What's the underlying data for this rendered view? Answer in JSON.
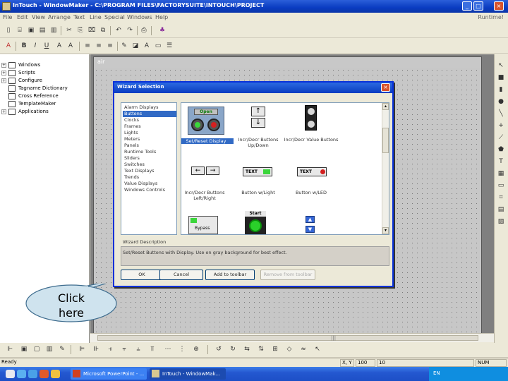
{
  "window": {
    "title": "InTouch - WindowMaker - C:\\PROGRAM FILES\\FACTORYSUITE\\INTOUCH\\PROJECT",
    "minimize": "_",
    "maximize": "□",
    "close": "×"
  },
  "menu": {
    "items": [
      "File",
      "Edit",
      "View",
      "Arrange",
      "Text",
      "Line",
      "Special",
      "Windows",
      "Help"
    ],
    "runtime": "Runtime!"
  },
  "tree": {
    "items": [
      {
        "label": "Windows",
        "expander": "+"
      },
      {
        "label": "Scripts",
        "expander": "+"
      },
      {
        "label": "Configure",
        "expander": "+"
      },
      {
        "label": "Tagname Dictionary",
        "expander": ""
      },
      {
        "label": "Cross Reference",
        "expander": ""
      },
      {
        "label": "TemplateMaker",
        "expander": ""
      },
      {
        "label": "Applications",
        "expander": "+"
      }
    ]
  },
  "canvas_window": {
    "title": "air"
  },
  "dialog": {
    "title": "Wizard Selection",
    "close": "×",
    "categories": [
      "Alarm Displays",
      "Buttons",
      "Clocks",
      "Frames",
      "Lights",
      "Meters",
      "Panels",
      "Runtime Tools",
      "Sliders",
      "Switches",
      "Text Displays",
      "Trends",
      "Value Displays",
      "Windows Controls"
    ],
    "selected_category": "Buttons",
    "wizards": [
      {
        "caption": "Set/Reset Display",
        "selected": true
      },
      {
        "caption": "Incr/Decr Buttons Up/Down",
        "selected": false
      },
      {
        "caption": "Incr/Decr Value Buttons",
        "selected": false
      },
      {
        "caption": "Incr/Decr Buttons Left/Right",
        "selected": false
      },
      {
        "caption": "Button w/Light",
        "selected": false
      },
      {
        "caption": "Button w/LED",
        "selected": false
      }
    ],
    "wizard_labels": {
      "open": "Open",
      "text": "TEXT",
      "start": "Start",
      "bypass": "Bypass"
    },
    "description_label": "Wizard Description",
    "description": "Set/Reset Buttons with Display.  Use on gray background for best effect.",
    "buttons": {
      "ok": "OK",
      "cancel": "Cancel",
      "add_toolbar": "Add to toolbar",
      "remove_toolbar": "Remove from toolbar"
    }
  },
  "statusbar": {
    "ready": "Ready",
    "xy_label": "X, Y",
    "x": "100",
    "y": "10",
    "num": "NUM"
  },
  "taskbar": {
    "tasks": [
      "Microsoft PowerPoint - ...",
      "InTouch - WindowMak..."
    ],
    "tray_lang": "EN"
  },
  "callout": {
    "line1": "Click",
    "line2": "here"
  },
  "colors": {
    "title_blue": "#0a3cc1",
    "selection": "#316ac5",
    "callout_fill": "#cfe3ee",
    "callout_stroke": "#3e6c8e",
    "led_green": "#3bd63b",
    "led_red": "#d42020"
  }
}
